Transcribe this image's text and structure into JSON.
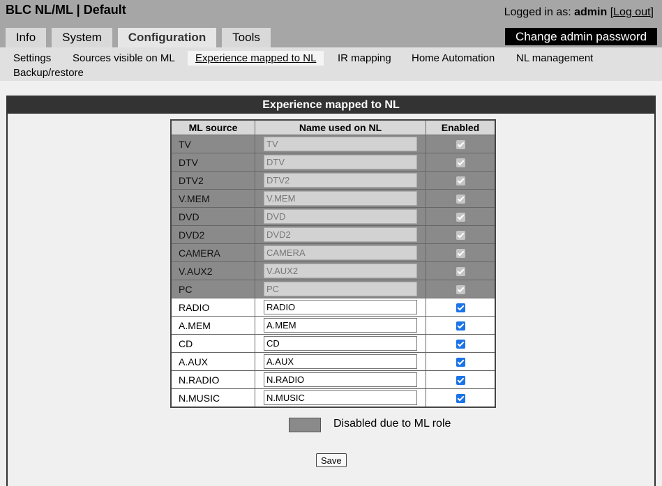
{
  "header": {
    "app_title": "BLC NL/ML  |  Default",
    "logged_in_prefix": "Logged in as: ",
    "username": "admin",
    "logout_open": "[",
    "logout_label": "Log out",
    "logout_close": "]"
  },
  "tabs": [
    {
      "label": "Info"
    },
    {
      "label": "System"
    },
    {
      "label": "Configuration"
    },
    {
      "label": "Tools"
    }
  ],
  "change_password_label": "Change admin password",
  "subnav": [
    {
      "label": "Settings"
    },
    {
      "label": "Sources visible on ML"
    },
    {
      "label": "Experience mapped to NL"
    },
    {
      "label": "IR mapping"
    },
    {
      "label": "Home Automation"
    },
    {
      "label": "NL management"
    },
    {
      "label": "Backup/restore"
    }
  ],
  "panel": {
    "title": "Experience mapped to NL",
    "columns": [
      "ML source",
      "Name used on NL",
      "Enabled"
    ],
    "rows": [
      {
        "source": "TV",
        "name": "TV",
        "enabled": true,
        "disabled": true
      },
      {
        "source": "DTV",
        "name": "DTV",
        "enabled": true,
        "disabled": true
      },
      {
        "source": "DTV2",
        "name": "DTV2",
        "enabled": true,
        "disabled": true
      },
      {
        "source": "V.MEM",
        "name": "V.MEM",
        "enabled": true,
        "disabled": true
      },
      {
        "source": "DVD",
        "name": "DVD",
        "enabled": true,
        "disabled": true
      },
      {
        "source": "DVD2",
        "name": "DVD2",
        "enabled": true,
        "disabled": true
      },
      {
        "source": "CAMERA",
        "name": "CAMERA",
        "enabled": true,
        "disabled": true
      },
      {
        "source": "V.AUX2",
        "name": "V.AUX2",
        "enabled": true,
        "disabled": true
      },
      {
        "source": "PC",
        "name": "PC",
        "enabled": true,
        "disabled": true
      },
      {
        "source": "RADIO",
        "name": "RADIO",
        "enabled": true,
        "disabled": false
      },
      {
        "source": "A.MEM",
        "name": "A.MEM",
        "enabled": true,
        "disabled": false
      },
      {
        "source": "CD",
        "name": "CD",
        "enabled": true,
        "disabled": false
      },
      {
        "source": "A.AUX",
        "name": "A.AUX",
        "enabled": true,
        "disabled": false
      },
      {
        "source": "N.RADIO",
        "name": "N.RADIO",
        "enabled": true,
        "disabled": false
      },
      {
        "source": "N.MUSIC",
        "name": "N.MUSIC",
        "enabled": true,
        "disabled": false
      }
    ],
    "legend_text": "Disabled due to ML role",
    "save_label": "Save"
  },
  "colors": {
    "header_bg": "#a6a6a6",
    "disabled_row": "#8a8a8a",
    "checkbox_on": "#1a73e8"
  }
}
